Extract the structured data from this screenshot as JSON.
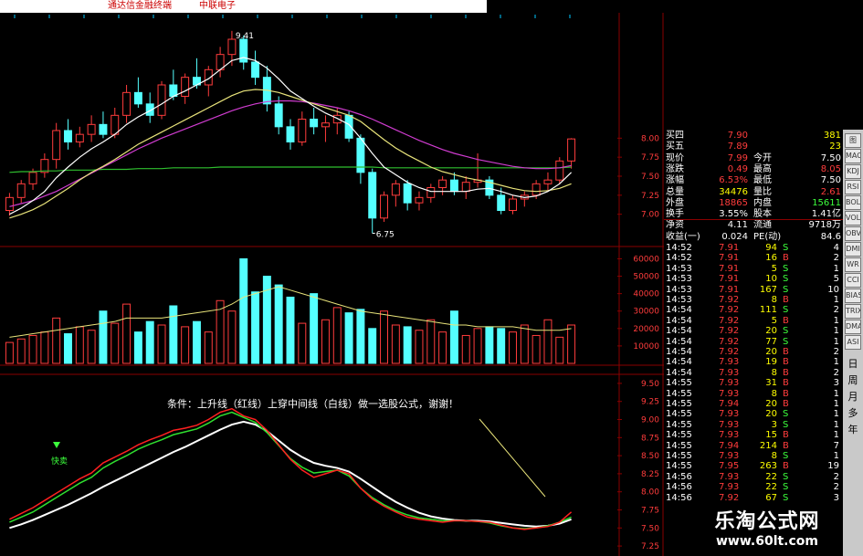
{
  "window": {
    "title_left": "通达信金融终端",
    "title_right": "中联电子"
  },
  "chart": {
    "high_label": "9.41",
    "low_label": "6.75",
    "price_axis": [
      "8.00",
      "7.75",
      "7.50",
      "7.25",
      "7.00"
    ],
    "volume_axis": [
      "60000",
      "50000",
      "40000",
      "30000",
      "20000",
      "10000"
    ],
    "indicator_axis": [
      "9.50",
      "9.25",
      "9.00",
      "8.75",
      "8.50",
      "8.25",
      "8.00",
      "7.75",
      "7.50",
      "7.25"
    ],
    "annotation": "条件：上升线（红线）上穿中间线（白线）做一选股公式，谢谢！",
    "signal_label": "快卖",
    "colors": {
      "up": "#ff3c3c",
      "down": "#54ffff",
      "ma_white": "#ffffff",
      "ma_yellow": "#e8e37a",
      "ma_magenta": "#d03cd0",
      "ma_green": "#2fbf2f",
      "grid": "#8a0000"
    }
  },
  "chart_data": {
    "type": "line",
    "title": "",
    "candles": {
      "ohlc": [
        [
          7.05,
          7.28,
          6.98,
          7.22
        ],
        [
          7.22,
          7.45,
          7.15,
          7.4
        ],
        [
          7.4,
          7.6,
          7.32,
          7.55
        ],
        [
          7.55,
          7.8,
          7.48,
          7.72
        ],
        [
          7.72,
          8.2,
          7.6,
          8.1
        ],
        [
          8.1,
          8.25,
          7.85,
          7.95
        ],
        [
          7.95,
          8.15,
          7.88,
          8.05
        ],
        [
          8.05,
          8.3,
          7.95,
          8.18
        ],
        [
          8.18,
          8.35,
          8.0,
          8.05
        ],
        [
          8.05,
          8.4,
          8.0,
          8.3
        ],
        [
          8.3,
          8.7,
          8.2,
          8.6
        ],
        [
          8.6,
          8.8,
          8.4,
          8.45
        ],
        [
          8.45,
          8.6,
          8.2,
          8.3
        ],
        [
          8.3,
          8.75,
          8.25,
          8.7
        ],
        [
          8.7,
          8.9,
          8.5,
          8.55
        ],
        [
          8.55,
          8.85,
          8.45,
          8.8
        ],
        [
          8.8,
          9.05,
          8.65,
          8.7
        ],
        [
          8.7,
          8.95,
          8.55,
          8.9
        ],
        [
          8.9,
          9.2,
          8.8,
          9.1
        ],
        [
          9.1,
          9.41,
          8.95,
          9.3
        ],
        [
          9.3,
          9.35,
          8.9,
          9.0
        ],
        [
          9.0,
          9.15,
          8.7,
          8.8
        ],
        [
          8.8,
          8.95,
          8.35,
          8.45
        ],
        [
          8.45,
          8.55,
          8.05,
          8.15
        ],
        [
          8.15,
          8.25,
          7.85,
          7.95
        ],
        [
          7.95,
          8.35,
          7.9,
          8.25
        ],
        [
          8.25,
          8.4,
          8.05,
          8.15
        ],
        [
          8.15,
          8.3,
          7.95,
          8.2
        ],
        [
          8.2,
          8.4,
          8.05,
          8.3
        ],
        [
          8.3,
          8.35,
          7.95,
          8.0
        ],
        [
          8.0,
          8.05,
          7.4,
          7.55
        ],
        [
          7.55,
          7.6,
          6.75,
          6.95
        ],
        [
          6.95,
          7.3,
          6.9,
          7.25
        ],
        [
          7.25,
          7.45,
          7.1,
          7.4
        ],
        [
          7.4,
          7.45,
          7.05,
          7.15
        ],
        [
          7.15,
          7.3,
          7.05,
          7.22
        ],
        [
          7.22,
          7.4,
          7.15,
          7.35
        ],
        [
          7.35,
          7.5,
          7.25,
          7.45
        ],
        [
          7.45,
          7.55,
          7.25,
          7.3
        ],
        [
          7.3,
          7.5,
          7.2,
          7.42
        ],
        [
          7.42,
          7.8,
          7.35,
          7.45
        ],
        [
          7.45,
          7.5,
          7.2,
          7.25
        ],
        [
          7.25,
          7.35,
          7.0,
          7.05
        ],
        [
          7.05,
          7.25,
          7.0,
          7.2
        ],
        [
          7.2,
          7.3,
          7.1,
          7.25
        ],
        [
          7.25,
          7.45,
          7.2,
          7.4
        ],
        [
          7.4,
          7.55,
          7.3,
          7.45
        ],
        [
          7.45,
          7.75,
          7.4,
          7.7
        ],
        [
          7.7,
          8.0,
          7.6,
          7.99
        ]
      ],
      "ma_white": [
        7.0,
        7.08,
        7.18,
        7.3,
        7.48,
        7.62,
        7.75,
        7.86,
        7.95,
        8.05,
        8.18,
        8.28,
        8.36,
        8.45,
        8.55,
        8.62,
        8.7,
        8.78,
        8.9,
        9.02,
        9.06,
        9.02,
        8.92,
        8.78,
        8.62,
        8.52,
        8.42,
        8.33,
        8.26,
        8.18,
        8.0,
        7.8,
        7.62,
        7.52,
        7.42,
        7.35,
        7.3,
        7.3,
        7.3,
        7.3,
        7.33,
        7.34,
        7.3,
        7.25,
        7.22,
        7.24,
        7.3,
        7.4,
        7.55
      ],
      "ma_yellow": [
        6.95,
        7.0,
        7.06,
        7.14,
        7.24,
        7.34,
        7.45,
        7.55,
        7.63,
        7.72,
        7.82,
        7.92,
        8.0,
        8.08,
        8.16,
        8.24,
        8.32,
        8.4,
        8.48,
        8.56,
        8.62,
        8.64,
        8.63,
        8.6,
        8.55,
        8.5,
        8.45,
        8.4,
        8.35,
        8.3,
        8.22,
        8.1,
        7.98,
        7.87,
        7.78,
        7.7,
        7.62,
        7.56,
        7.52,
        7.48,
        7.45,
        7.42,
        7.38,
        7.34,
        7.31,
        7.3,
        7.31,
        7.34,
        7.4
      ],
      "ma_magenta": [
        7.1,
        7.14,
        7.18,
        7.24,
        7.3,
        7.38,
        7.46,
        7.54,
        7.62,
        7.7,
        7.78,
        7.86,
        7.93,
        8.0,
        8.06,
        8.12,
        8.18,
        8.24,
        8.3,
        8.36,
        8.41,
        8.45,
        8.48,
        8.49,
        8.49,
        8.48,
        8.46,
        8.43,
        8.4,
        8.36,
        8.31,
        8.25,
        8.18,
        8.11,
        8.04,
        7.97,
        7.91,
        7.85,
        7.8,
        7.76,
        7.72,
        7.69,
        7.66,
        7.63,
        7.61,
        7.6,
        7.6,
        7.61,
        7.64
      ],
      "ma_green": [
        7.55,
        7.56,
        7.56,
        7.57,
        7.57,
        7.58,
        7.58,
        7.58,
        7.59,
        7.59,
        7.59,
        7.6,
        7.6,
        7.6,
        7.61,
        7.61,
        7.61,
        7.61,
        7.62,
        7.62,
        7.62,
        7.62,
        7.62,
        7.62,
        7.62,
        7.62,
        7.62,
        7.62,
        7.62,
        7.62,
        7.62,
        7.62,
        7.61,
        7.61,
        7.61,
        7.61,
        7.61,
        7.61,
        7.61,
        7.61,
        7.61,
        7.61,
        7.61,
        7.61,
        7.61,
        7.61,
        7.61,
        7.61,
        7.62
      ]
    },
    "volume": {
      "values": [
        12000,
        14000,
        16000,
        18000,
        26000,
        17000,
        21000,
        19000,
        30000,
        23000,
        34000,
        18000,
        24000,
        22000,
        33000,
        21000,
        24000,
        18000,
        36000,
        30000,
        60000,
        41000,
        50000,
        45000,
        38000,
        23000,
        40000,
        25000,
        32000,
        29000,
        31000,
        20000,
        30000,
        22000,
        21000,
        19000,
        25000,
        18000,
        30000,
        16000,
        20000,
        21000,
        20000,
        18000,
        22000,
        16000,
        25000,
        15000,
        22000
      ],
      "ma": [
        15000,
        16000,
        17000,
        18000,
        19000,
        20000,
        21000,
        22000,
        23000,
        24000,
        26000,
        26000,
        26000,
        26000,
        27000,
        28000,
        29000,
        30000,
        31000,
        34000,
        38000,
        40000,
        42000,
        44000,
        42000,
        40000,
        38000,
        36000,
        34000,
        32000,
        30000,
        29000,
        28000,
        27000,
        26000,
        25000,
        24000,
        23000,
        22000,
        22000,
        21000,
        21000,
        21000,
        21000,
        20000,
        19000,
        19000,
        19000,
        20000
      ]
    },
    "indicator": {
      "red": [
        7.62,
        7.7,
        7.78,
        7.88,
        7.98,
        8.08,
        8.18,
        8.26,
        8.4,
        8.48,
        8.56,
        8.65,
        8.72,
        8.78,
        8.85,
        8.88,
        8.92,
        9.0,
        9.1,
        9.15,
        9.05,
        9.0,
        8.85,
        8.65,
        8.45,
        8.3,
        8.2,
        8.25,
        8.3,
        8.25,
        8.05,
        7.9,
        7.8,
        7.72,
        7.65,
        7.62,
        7.6,
        7.58,
        7.6,
        7.6,
        7.59,
        7.58,
        7.54,
        7.5,
        7.48,
        7.5,
        7.52,
        7.58,
        7.72
      ],
      "green": [
        7.58,
        7.65,
        7.72,
        7.82,
        7.92,
        8.02,
        8.12,
        8.2,
        8.33,
        8.42,
        8.5,
        8.59,
        8.66,
        8.72,
        8.79,
        8.83,
        8.87,
        8.95,
        9.05,
        9.1,
        9.03,
        8.96,
        8.82,
        8.64,
        8.46,
        8.34,
        8.26,
        8.28,
        8.3,
        8.22,
        8.05,
        7.92,
        7.82,
        7.74,
        7.68,
        7.64,
        7.62,
        7.6,
        7.6,
        7.6,
        7.59,
        7.57,
        7.53,
        7.5,
        7.49,
        7.5,
        7.53,
        7.58,
        7.65
      ],
      "white": [
        7.5,
        7.55,
        7.61,
        7.68,
        7.75,
        7.82,
        7.9,
        7.98,
        8.07,
        8.15,
        8.23,
        8.31,
        8.39,
        8.47,
        8.55,
        8.62,
        8.7,
        8.78,
        8.86,
        8.93,
        8.97,
        8.93,
        8.84,
        8.71,
        8.58,
        8.48,
        8.4,
        8.36,
        8.33,
        8.28,
        8.18,
        8.07,
        7.96,
        7.86,
        7.78,
        7.71,
        7.66,
        7.63,
        7.61,
        7.6,
        7.6,
        7.59,
        7.57,
        7.55,
        7.53,
        7.52,
        7.53,
        7.56,
        7.62
      ]
    },
    "price_range": [
      6.6,
      9.6
    ],
    "volume_range": [
      0,
      66000
    ],
    "indicator_range": [
      7.15,
      9.6
    ]
  },
  "quote": {
    "rows": [
      {
        "k1": "买四",
        "v1": "7.90",
        "c1": "#ff3c3c",
        "v2": "381",
        "c2": "#ffff00"
      },
      {
        "k1": "买五",
        "v1": "7.89",
        "c1": "#ff3c3c",
        "v2": "23",
        "c2": "#ffff00"
      },
      {
        "k1": "现价",
        "v1": "7.99",
        "c1": "#ff3c3c",
        "k2": "今开",
        "v2": "7.50",
        "c2": "#ffffff"
      },
      {
        "k1": "涨跌",
        "v1": "0.49",
        "c1": "#ff3c3c",
        "k2": "最高",
        "v2": "8.05",
        "c2": "#ff3c3c"
      },
      {
        "k1": "涨幅",
        "v1": "6.53%",
        "c1": "#ff3c3c",
        "k2": "最低",
        "v2": "7.50",
        "c2": "#ffffff"
      },
      {
        "k1": "总量",
        "v1": "34476",
        "c1": "#ffff00",
        "k2": "量比",
        "v2": "2.61",
        "c2": "#ff3c3c"
      },
      {
        "k1": "外盘",
        "v1": "18865",
        "c1": "#ff3c3c",
        "k2": "内盘",
        "v2": "15611",
        "c2": "#3cff3c"
      },
      {
        "k1": "换手",
        "v1": "3.55%",
        "c1": "#ffffff",
        "k2": "股本",
        "v2": "1.41亿",
        "c2": "#ffffff"
      },
      {
        "k1": "净资",
        "v1": "4.11",
        "c1": "#ffffff",
        "k2": "流通",
        "v2": "9718万",
        "c2": "#ffffff"
      },
      {
        "k1": "收益(一)",
        "v1": "0.024",
        "c1": "#ffffff",
        "k2": "PE(动)",
        "v2": "84.6",
        "c2": "#ffffff"
      }
    ]
  },
  "ticks": [
    {
      "t": "14:52",
      "p": "7.91",
      "v": "94",
      "s": "S",
      "n": "4"
    },
    {
      "t": "14:52",
      "p": "7.91",
      "v": "16",
      "s": "B",
      "n": "2"
    },
    {
      "t": "14:53",
      "p": "7.91",
      "v": "5",
      "s": "S",
      "n": "1"
    },
    {
      "t": "14:53",
      "p": "7.91",
      "v": "10",
      "s": "S",
      "n": "5"
    },
    {
      "t": "14:53",
      "p": "7.91",
      "v": "167",
      "s": "S",
      "n": "10"
    },
    {
      "t": "14:53",
      "p": "7.92",
      "v": "8",
      "s": "B",
      "n": "1"
    },
    {
      "t": "14:54",
      "p": "7.92",
      "v": "111",
      "s": "S",
      "n": "2"
    },
    {
      "t": "14:54",
      "p": "7.92",
      "v": "5",
      "s": "B",
      "n": "1"
    },
    {
      "t": "14:54",
      "p": "7.92",
      "v": "20",
      "s": "S",
      "n": "1"
    },
    {
      "t": "14:54",
      "p": "7.92",
      "v": "77",
      "s": "S",
      "n": "1"
    },
    {
      "t": "14:54",
      "p": "7.92",
      "v": "20",
      "s": "B",
      "n": "2"
    },
    {
      "t": "14:54",
      "p": "7.93",
      "v": "19",
      "s": "B",
      "n": "1"
    },
    {
      "t": "14:54",
      "p": "7.93",
      "v": "8",
      "s": "B",
      "n": "2"
    },
    {
      "t": "14:55",
      "p": "7.93",
      "v": "31",
      "s": "B",
      "n": "3"
    },
    {
      "t": "14:55",
      "p": "7.93",
      "v": "8",
      "s": "B",
      "n": "1"
    },
    {
      "t": "14:55",
      "p": "7.94",
      "v": "20",
      "s": "B",
      "n": "1"
    },
    {
      "t": "14:55",
      "p": "7.93",
      "v": "20",
      "s": "S",
      "n": "1"
    },
    {
      "t": "14:55",
      "p": "7.93",
      "v": "3",
      "s": "S",
      "n": "1"
    },
    {
      "t": "14:55",
      "p": "7.93",
      "v": "15",
      "s": "B",
      "n": "1"
    },
    {
      "t": "14:55",
      "p": "7.94",
      "v": "214",
      "s": "B",
      "n": "7"
    },
    {
      "t": "14:55",
      "p": "7.93",
      "v": "8",
      "s": "S",
      "n": "1"
    },
    {
      "t": "14:55",
      "p": "7.95",
      "v": "263",
      "s": "B",
      "n": "19"
    },
    {
      "t": "14:56",
      "p": "7.93",
      "v": "22",
      "s": "S",
      "n": "2"
    },
    {
      "t": "14:56",
      "p": "7.93",
      "v": "22",
      "s": "S",
      "n": "2"
    },
    {
      "t": "14:56",
      "p": "7.92",
      "v": "67",
      "s": "S",
      "n": "3"
    }
  ],
  "sidebar": {
    "buttons": [
      "图",
      "MACD",
      "KDJ",
      "RSI",
      "BOLL",
      "VOL",
      "OBV",
      "DMI",
      "WR",
      "CCI",
      "BIAS",
      "TRIX",
      "DMA",
      "ASI"
    ],
    "periods": [
      "日",
      "周",
      "月",
      "多",
      "年"
    ]
  },
  "watermark": {
    "line1": "乐淘公式网",
    "line2": "www.60lt.com"
  }
}
